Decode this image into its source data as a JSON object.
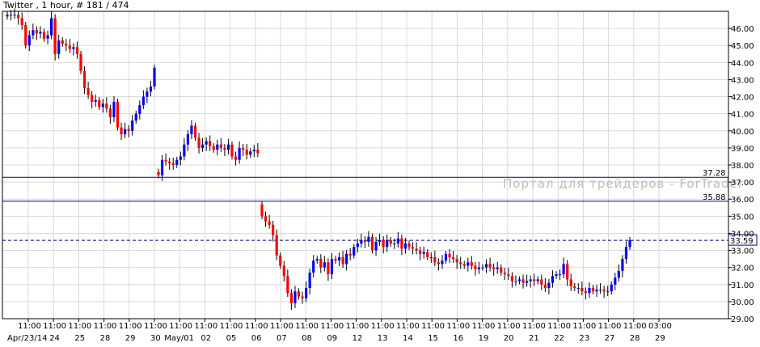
{
  "chart_data": {
    "type": "candlestick",
    "title": "Twitter , 1 hour, # 181 / 474",
    "watermark": "Портал для трейдеров - ForTrader",
    "ylim": [
      29.0,
      47.0
    ],
    "y_ticks": [
      "29.00",
      "30.00",
      "31.00",
      "32.00",
      "33.00",
      "34.00",
      "35.00",
      "36.00",
      "37.00",
      "38.00",
      "39.00",
      "40.00",
      "41.00",
      "42.00",
      "43.00",
      "44.00",
      "45.00",
      "46.00"
    ],
    "x_ticks": [
      {
        "time": "11:00",
        "date": "Apr/23/14"
      },
      {
        "time": "11:00",
        "date": "24"
      },
      {
        "time": "11:00",
        "date": "25"
      },
      {
        "time": "11:00",
        "date": "28"
      },
      {
        "time": "11:00",
        "date": "29"
      },
      {
        "time": "11:00",
        "date": "30"
      },
      {
        "time": "11:00",
        "date": "May/01"
      },
      {
        "time": "11:00",
        "date": "02"
      },
      {
        "time": "11:00",
        "date": "05"
      },
      {
        "time": "11:00",
        "date": "06"
      },
      {
        "time": "11:00",
        "date": "07"
      },
      {
        "time": "11:00",
        "date": "08"
      },
      {
        "time": "11:00",
        "date": "09"
      },
      {
        "time": "11:00",
        "date": "12"
      },
      {
        "time": "11:00",
        "date": "13"
      },
      {
        "time": "11:00",
        "date": "14"
      },
      {
        "time": "11:00",
        "date": "15"
      },
      {
        "time": "11:00",
        "date": "16"
      },
      {
        "time": "11:00",
        "date": "19"
      },
      {
        "time": "11:00",
        "date": "20"
      },
      {
        "time": "11:00",
        "date": "21"
      },
      {
        "time": "11:00",
        "date": "22"
      },
      {
        "time": "11:00",
        "date": "23"
      },
      {
        "time": "11:00",
        "date": "27"
      },
      {
        "time": "11:00",
        "date": "28"
      },
      {
        "time": "03:00",
        "date": "29"
      }
    ],
    "levels": [
      {
        "value": 37.28,
        "label": "37.28",
        "style": "solid",
        "color": "#000080"
      },
      {
        "value": 35.88,
        "label": "35.88",
        "style": "solid",
        "color": "#000080"
      },
      {
        "value": 33.59,
        "label": "33.59",
        "style": "dashed",
        "color": "#000080",
        "boxed": true
      }
    ],
    "colors": {
      "up": "#0000ff",
      "down": "#ff0000",
      "wick": "#000000",
      "grid": "#d9d9d9"
    },
    "grid": true,
    "segments": [
      {
        "start": 46.7,
        "closes": [
          46.8,
          46.8,
          46.8,
          46.6,
          46.2,
          45.0,
          45.6,
          45.9,
          45.7,
          45.8,
          45.4,
          45.6,
          46.6,
          44.5,
          45.3,
          45.1,
          45.0,
          44.8,
          44.9,
          44.5,
          43.5,
          42.5,
          42.1,
          41.7,
          41.8,
          41.4,
          41.6,
          41.3,
          40.8,
          41.7,
          40.2,
          39.8,
          40.1,
          40.0,
          40.6,
          41.0,
          41.5,
          42.0,
          42.3,
          42.6,
          43.7
        ]
      },
      {
        "start": 37.6,
        "closes": [
          37.4,
          38.3,
          38.2,
          38.1,
          38.0,
          38.3,
          38.5,
          39.2,
          39.8,
          40.3,
          39.6,
          39.0,
          39.2,
          39.4,
          39.1,
          38.9,
          39.2,
          39.0,
          38.9,
          39.2,
          38.5,
          38.3,
          39.0,
          38.9,
          38.6,
          38.8,
          38.9,
          38.7
        ]
      },
      {
        "start": 35.7,
        "closes": [
          35.0,
          34.7,
          34.5,
          33.9,
          32.7,
          32.1,
          31.5,
          30.5,
          29.9,
          30.6,
          30.3,
          30.2,
          30.8,
          31.7,
          32.4,
          32.5,
          32.0,
          32.3,
          31.6,
          32.5,
          32.4,
          32.6,
          32.2,
          32.8,
          32.7,
          33.2,
          33.4,
          33.6,
          33.5,
          33.8,
          33.0,
          33.5,
          33.6,
          33.2,
          33.6,
          33.4,
          33.4,
          33.7,
          33.1,
          33.4,
          33.2,
          33.1,
          33.0,
          32.8,
          32.9,
          32.6,
          32.6,
          32.3,
          32.2,
          32.4,
          32.8,
          32.6,
          32.5,
          32.3,
          32.2,
          32.1,
          32.3,
          32.1,
          31.9,
          32.0,
          32.0,
          32.2,
          32.0,
          31.9,
          32.0,
          31.7,
          31.6,
          31.5,
          31.2,
          31.2,
          31.3,
          31.1,
          31.2,
          31.3,
          31.2,
          31.3,
          31.0,
          30.8,
          31.1,
          31.5,
          31.6,
          31.6,
          32.2,
          31.3,
          30.9,
          30.8,
          30.8,
          30.6,
          30.5,
          30.8,
          30.6,
          30.7,
          30.7,
          30.6,
          30.6,
          31.0,
          31.4,
          31.8,
          32.5,
          33.2,
          33.6
        ]
      }
    ]
  }
}
